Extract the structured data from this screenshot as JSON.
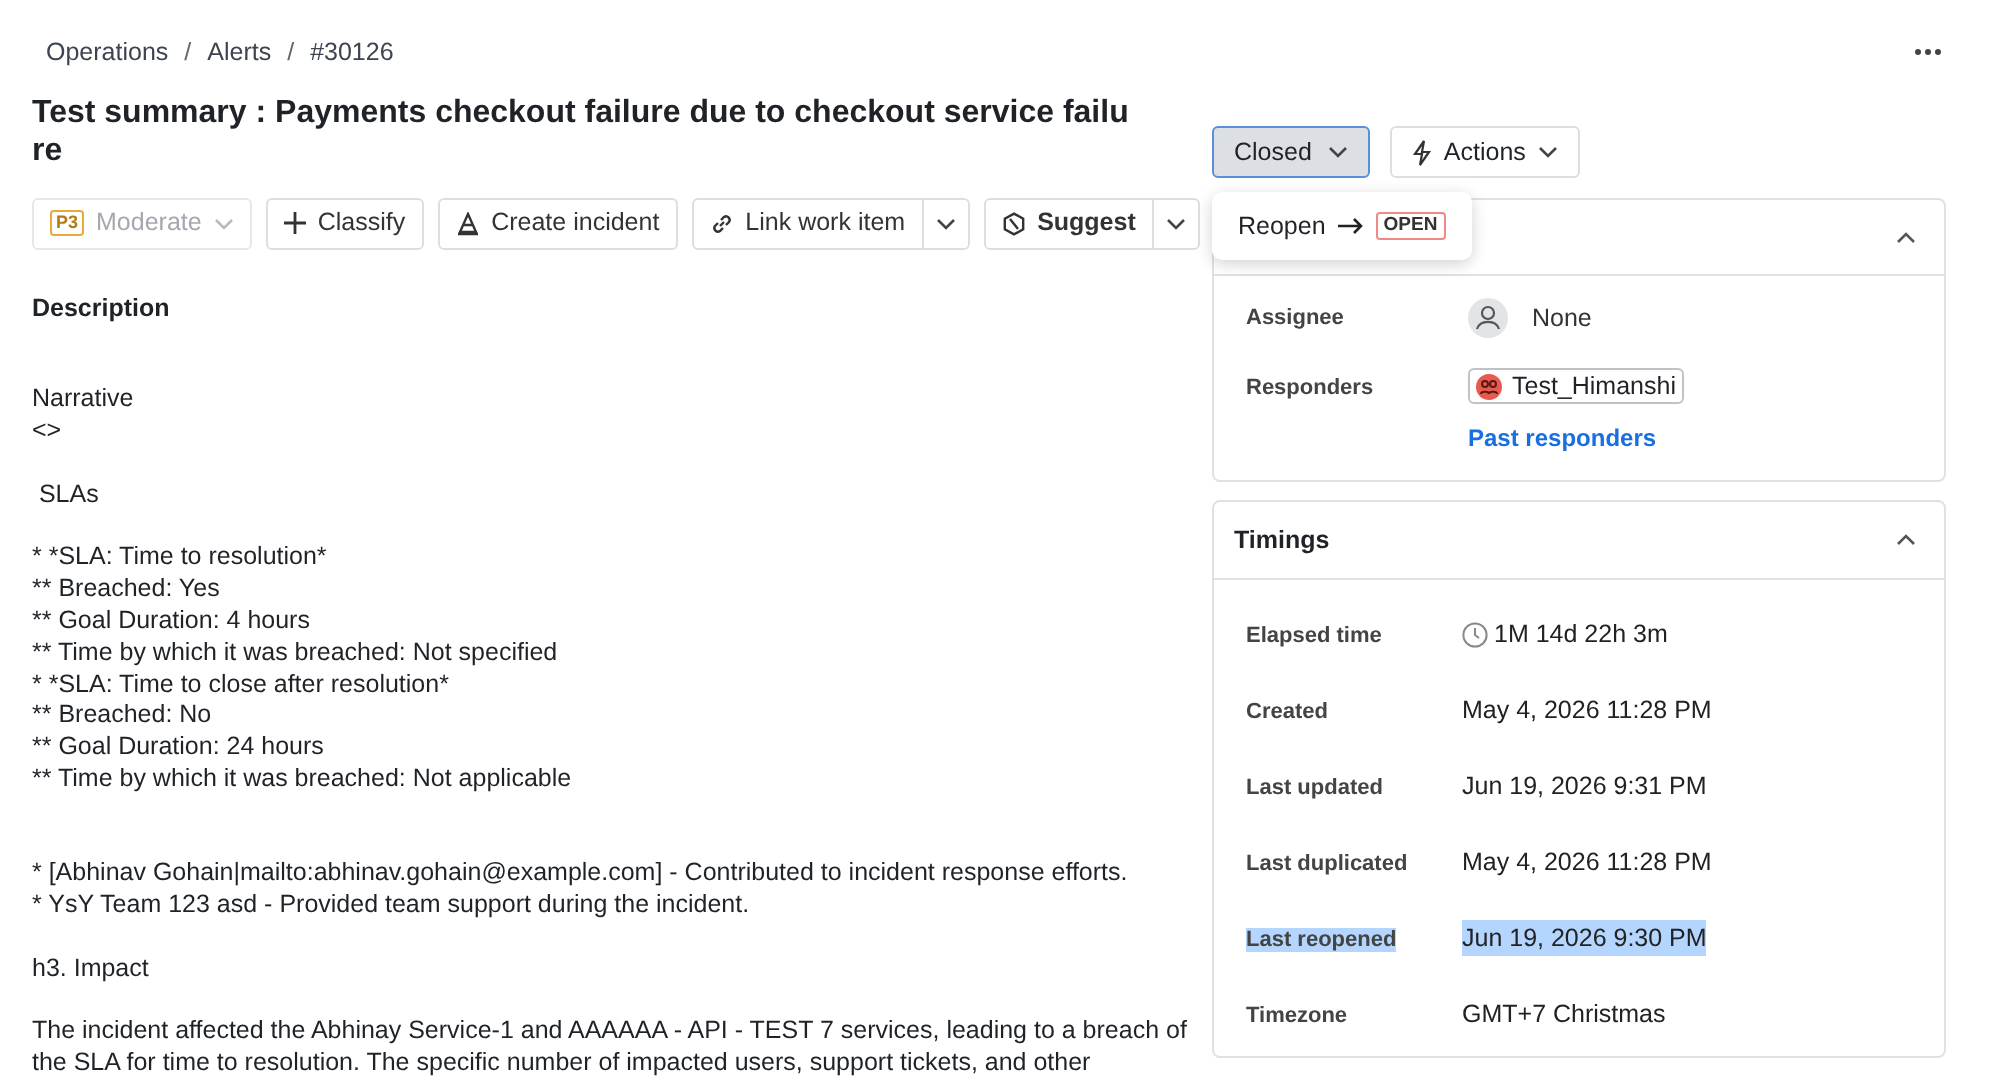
{
  "breadcrumbs": {
    "separator": "/",
    "items": [
      {
        "label": "Operations"
      },
      {
        "label": "Alerts"
      },
      {
        "label": "#30126"
      }
    ]
  },
  "title": "Test summary : Payments checkout failure due to checkout service failure",
  "toolbar": {
    "priority": {
      "badge": "P3",
      "label": "Moderate",
      "disabled": true
    },
    "buttons": [
      {
        "kind": "plus",
        "label": "Classify"
      },
      {
        "kind": "cone",
        "label": "Create incident"
      },
      {
        "kind": "link",
        "label": "Link work item",
        "split": true
      },
      {
        "kind": "hex",
        "label": "Suggest",
        "split": true
      }
    ]
  },
  "description": {
    "heading": "Description",
    "paragraphs": [
      {
        "lines": [
          "Narrative",
          "<>"
        ]
      },
      {
        "lines": [
          " SLAs"
        ]
      },
      {
        "lines": [
          "* *SLA: Time to resolution*",
          "** Breached: Yes",
          "** Goal Duration: 4 hours",
          "** Time by which it was breached: Not specified",
          "* *SLA: Time to close after resolution*",
          "** Breached: No",
          "** Goal Duration: 24 hours",
          "** Time by which it was breached: Not applicable"
        ]
      },
      {
        "lines": [
          "* [Abhinav Gohain|mailto:abhinav.gohain@example.com] - Contributed to incident response efforts.",
          "* YsY Team 123 asd - Provided team support during the incident."
        ]
      },
      {
        "lines": [
          "h3. Impact"
        ]
      },
      {
        "lines": [
          "The incident affected the Abhinay Service-1 and AAAAAA - API - TEST 7 services, leading to a breach of",
          "the SLA for time to resolution. The specific number of impacted users, support tickets, and other"
        ]
      }
    ]
  },
  "status_button": {
    "label": "Closed",
    "expanded": true
  },
  "actions_button": {
    "label": "Actions"
  },
  "status_menu": {
    "items": [
      {
        "label": "Reopen",
        "badge": "OPEN"
      }
    ]
  },
  "details": {
    "expanded": true,
    "assignee": {
      "label": "Assignee",
      "value": "None"
    },
    "responders": {
      "label": "Responders",
      "chips": [
        "Test_Himanshi"
      ],
      "link": "Past responders"
    }
  },
  "timings": {
    "title": "Timings",
    "expanded": true,
    "rows": [
      {
        "label": "Elapsed time",
        "value": "1M 14d 22h 3m",
        "kind": "duration",
        "highlighted": false
      },
      {
        "label": "Created",
        "value": "May 4, 2026 11:28 PM",
        "kind": "date",
        "highlighted": false
      },
      {
        "label": "Last updated",
        "value": "Jun 19, 2026 9:31 PM",
        "kind": "date",
        "highlighted": false
      },
      {
        "label": "Last duplicated",
        "value": "May 4, 2026 11:28 PM",
        "kind": "date",
        "highlighted": false
      },
      {
        "label": "Last reopened",
        "value": "Jun 19, 2026 9:30 PM",
        "kind": "date",
        "highlighted": true
      },
      {
        "label": "Timezone",
        "value": "GMT+7 Christmas",
        "kind": "text",
        "highlighted": false
      }
    ]
  }
}
